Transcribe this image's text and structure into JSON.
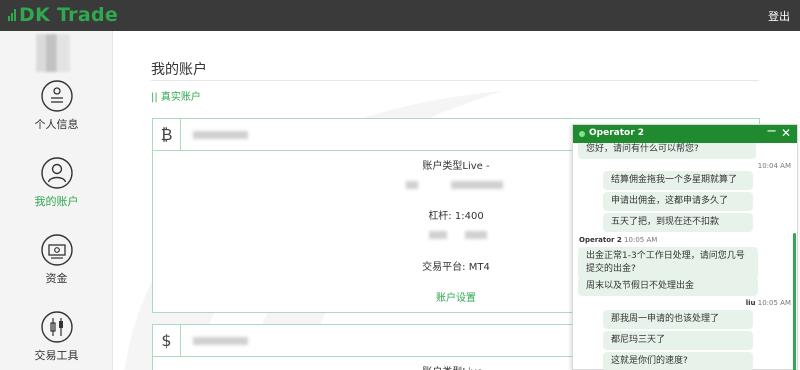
{
  "app": {
    "logo_text": "DK Trade",
    "logout_label": "登出"
  },
  "sidebar": {
    "items": [
      {
        "label": "个人信息",
        "icon": "profile-icon"
      },
      {
        "label": "我的账户",
        "icon": "user-icon",
        "active": true
      },
      {
        "label": "资金",
        "icon": "money-icon"
      },
      {
        "label": "交易工具",
        "icon": "tools-icon"
      }
    ]
  },
  "main": {
    "title": "我的账户",
    "account_type_link": "|| 真实账户",
    "card1": {
      "currency": "₿",
      "account_type": "账户类型Live -",
      "leverage": "杠杆: 1:400",
      "platform": "交易平台:    MT4",
      "settings_link": "账户设置"
    },
    "card2": {
      "currency": "$",
      "account_type": "账户类型Live -"
    }
  },
  "chat": {
    "operator_name": "Operator 2",
    "messages": [
      {
        "side": "left",
        "text": "您好，请问有什么可以帮您?"
      },
      {
        "side": "meta-right",
        "time": "10:04 AM"
      },
      {
        "side": "right",
        "text": "结算佣金拖我一个多星期就算了"
      },
      {
        "side": "right",
        "text": "申请出佣金，这都申请多久了"
      },
      {
        "side": "right",
        "text": "五天了把，到现在还不扣款"
      },
      {
        "side": "meta-left",
        "sender": "Operator 2",
        "time": "10:05 AM"
      },
      {
        "side": "left",
        "text": "出金正常1-3个工作日处理，请问您几号提交的出金?"
      },
      {
        "side": "left",
        "text": "周末以及节假日不处理出金"
      },
      {
        "side": "meta-right",
        "sender": "liu",
        "time": "10:05 AM"
      },
      {
        "side": "right",
        "text": "那我周一申请的也该处理了"
      },
      {
        "side": "right",
        "text": "都尼玛三天了"
      },
      {
        "side": "right",
        "text": "这就是你们的速度?"
      }
    ]
  },
  "colors": {
    "brand_green": "#2fa84f",
    "chat_header": "#1f8b2e",
    "topbar": "#3a3a3a"
  }
}
